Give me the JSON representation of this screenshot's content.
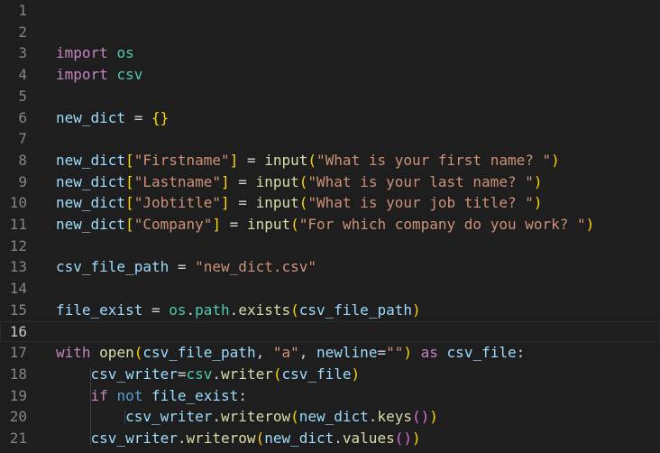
{
  "editor": {
    "current_line": 16,
    "lines": [
      {
        "n": "1",
        "tokens": []
      },
      {
        "n": "2",
        "tokens": []
      },
      {
        "n": "3",
        "tokens": [
          [
            "kw",
            "import"
          ],
          [
            "punc",
            " "
          ],
          [
            "mod",
            "os"
          ]
        ]
      },
      {
        "n": "4",
        "tokens": [
          [
            "kw",
            "import"
          ],
          [
            "punc",
            " "
          ],
          [
            "mod",
            "csv"
          ]
        ]
      },
      {
        "n": "5",
        "tokens": []
      },
      {
        "n": "6",
        "tokens": [
          [
            "var",
            "new_dict"
          ],
          [
            "punc",
            " = "
          ],
          [
            "br1",
            "{}"
          ]
        ]
      },
      {
        "n": "7",
        "tokens": []
      },
      {
        "n": "8",
        "tokens": [
          [
            "var",
            "new_dict"
          ],
          [
            "br1",
            "["
          ],
          [
            "str",
            "\"Firstname\""
          ],
          [
            "br1",
            "]"
          ],
          [
            "punc",
            " = "
          ],
          [
            "fn",
            "input"
          ],
          [
            "br1",
            "("
          ],
          [
            "str",
            "\"What is your first name? \""
          ],
          [
            "br1",
            ")"
          ]
        ]
      },
      {
        "n": "9",
        "tokens": [
          [
            "var",
            "new_dict"
          ],
          [
            "br1",
            "["
          ],
          [
            "str",
            "\"Lastname\""
          ],
          [
            "br1",
            "]"
          ],
          [
            "punc",
            " = "
          ],
          [
            "fn",
            "input"
          ],
          [
            "br1",
            "("
          ],
          [
            "str",
            "\"What is your last name? \""
          ],
          [
            "br1",
            ")"
          ]
        ]
      },
      {
        "n": "10",
        "tokens": [
          [
            "var",
            "new_dict"
          ],
          [
            "br1",
            "["
          ],
          [
            "str",
            "\"Jobtitle\""
          ],
          [
            "br1",
            "]"
          ],
          [
            "punc",
            " = "
          ],
          [
            "fn",
            "input"
          ],
          [
            "br1",
            "("
          ],
          [
            "str",
            "\"What is your job title? \""
          ],
          [
            "br1",
            ")"
          ]
        ]
      },
      {
        "n": "11",
        "tokens": [
          [
            "var",
            "new_dict"
          ],
          [
            "br1",
            "["
          ],
          [
            "str",
            "\"Company\""
          ],
          [
            "br1",
            "]"
          ],
          [
            "punc",
            " = "
          ],
          [
            "fn",
            "input"
          ],
          [
            "br1",
            "("
          ],
          [
            "str",
            "\"For which company do you work? \""
          ],
          [
            "br1",
            ")"
          ]
        ]
      },
      {
        "n": "12",
        "tokens": []
      },
      {
        "n": "13",
        "tokens": [
          [
            "var",
            "csv_file_path"
          ],
          [
            "punc",
            " = "
          ],
          [
            "str",
            "\"new_dict.csv\""
          ]
        ]
      },
      {
        "n": "14",
        "tokens": []
      },
      {
        "n": "15",
        "tokens": [
          [
            "var",
            "file_exist"
          ],
          [
            "punc",
            " = "
          ],
          [
            "mod",
            "os"
          ],
          [
            "punc",
            "."
          ],
          [
            "mod",
            "path"
          ],
          [
            "punc",
            "."
          ],
          [
            "fn",
            "exists"
          ],
          [
            "br1",
            "("
          ],
          [
            "var",
            "csv_file_path"
          ],
          [
            "br1",
            ")"
          ]
        ]
      },
      {
        "n": "16",
        "tokens": []
      },
      {
        "n": "17",
        "tokens": [
          [
            "kw",
            "with"
          ],
          [
            "punc",
            " "
          ],
          [
            "fn",
            "open"
          ],
          [
            "br1",
            "("
          ],
          [
            "var",
            "csv_file_path"
          ],
          [
            "punc",
            ", "
          ],
          [
            "str",
            "\"a\""
          ],
          [
            "punc",
            ", "
          ],
          [
            "var",
            "newline"
          ],
          [
            "punc",
            "="
          ],
          [
            "str",
            "\"\""
          ],
          [
            "br1",
            ")"
          ],
          [
            "punc",
            " "
          ],
          [
            "kw",
            "as"
          ],
          [
            "punc",
            " "
          ],
          [
            "var",
            "csv_file"
          ],
          [
            "punc",
            ":"
          ]
        ]
      },
      {
        "n": "18",
        "tokens": [
          [
            "punc",
            "    "
          ],
          [
            "var",
            "csv_writer"
          ],
          [
            "punc",
            "="
          ],
          [
            "mod",
            "csv"
          ],
          [
            "punc",
            "."
          ],
          [
            "fn",
            "writer"
          ],
          [
            "br1",
            "("
          ],
          [
            "var",
            "csv_file"
          ],
          [
            "br1",
            ")"
          ]
        ]
      },
      {
        "n": "19",
        "tokens": [
          [
            "punc",
            "    "
          ],
          [
            "kw",
            "if"
          ],
          [
            "punc",
            " "
          ],
          [
            "ctl",
            "not"
          ],
          [
            "punc",
            " "
          ],
          [
            "var",
            "file_exist"
          ],
          [
            "punc",
            ":"
          ]
        ]
      },
      {
        "n": "20",
        "tokens": [
          [
            "punc",
            "        "
          ],
          [
            "var",
            "csv_writer"
          ],
          [
            "punc",
            "."
          ],
          [
            "fn",
            "writerow"
          ],
          [
            "br1",
            "("
          ],
          [
            "var",
            "new_dict"
          ],
          [
            "punc",
            "."
          ],
          [
            "fn",
            "keys"
          ],
          [
            "br2",
            "()"
          ],
          [
            "br1",
            ")"
          ]
        ]
      },
      {
        "n": "21",
        "tokens": [
          [
            "punc",
            "    "
          ],
          [
            "var",
            "csv_writer"
          ],
          [
            "punc",
            "."
          ],
          [
            "fn",
            "writerow"
          ],
          [
            "br1",
            "("
          ],
          [
            "var",
            "new_dict"
          ],
          [
            "punc",
            "."
          ],
          [
            "fn",
            "values"
          ],
          [
            "br2",
            "()"
          ],
          [
            "br1",
            ")"
          ]
        ]
      }
    ]
  }
}
